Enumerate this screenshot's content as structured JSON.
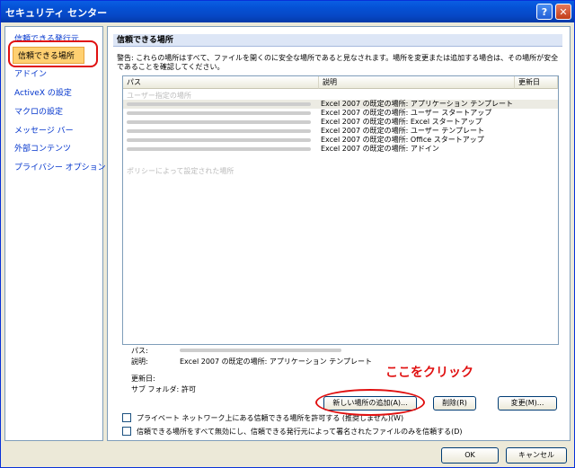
{
  "window": {
    "title": "セキュリティ センター"
  },
  "sidebar": {
    "items": [
      {
        "label": "信頼できる発行元"
      },
      {
        "label": "信頼できる場所"
      },
      {
        "label": "アドイン"
      },
      {
        "label": "ActiveX の設定"
      },
      {
        "label": "マクロの設定"
      },
      {
        "label": "メッセージ バー"
      },
      {
        "label": "外部コンテンツ"
      },
      {
        "label": "プライバシー オプション"
      }
    ]
  },
  "main": {
    "header": "信頼できる場所",
    "warning": "警告: これらの場所はすべて、ファイルを開くのに安全な場所であると見なされます。場所を変更または追加する場合は、その場所が安全であることを確認してください。",
    "columns": [
      "パス",
      "説明",
      "更新日"
    ],
    "user_group": "ユーザー指定の場所",
    "policy_group": "ポリシーによって設定された場所",
    "rows": [
      {
        "desc": "Excel 2007 の既定の場所: アプリケーション テンプレート"
      },
      {
        "desc": "Excel 2007 の既定の場所: ユーザー スタートアップ"
      },
      {
        "desc": "Excel 2007 の既定の場所: Excel スタートアップ"
      },
      {
        "desc": "Excel 2007 の既定の場所: ユーザー テンプレート"
      },
      {
        "desc": "Excel 2007 の既定の場所: Office スタートアップ"
      },
      {
        "desc": "Excel 2007 の既定の場所: アドイン"
      }
    ],
    "details": {
      "path_label": "パス:",
      "desc_label": "説明:",
      "desc_value": "Excel 2007 の既定の場所: アプリケーション テンプレート",
      "date_label": "更新日:",
      "subfolder_label": "サブ フォルダ:",
      "subfolder_value": "許可"
    },
    "buttons": {
      "add": "新しい場所の追加(A)...",
      "remove": "削除(R)",
      "modify": "変更(M)..."
    },
    "checkboxes": {
      "allow_network": "プライベート ネットワーク上にある信頼できる場所を許可する (推奨しません)(W)",
      "disable_all": "信頼できる場所をすべて無効にし、信頼できる発行元によって署名されたファイルのみを信頼する(D)"
    }
  },
  "annotation": "ここをクリック",
  "footer": {
    "ok": "OK",
    "cancel": "キャンセル"
  }
}
